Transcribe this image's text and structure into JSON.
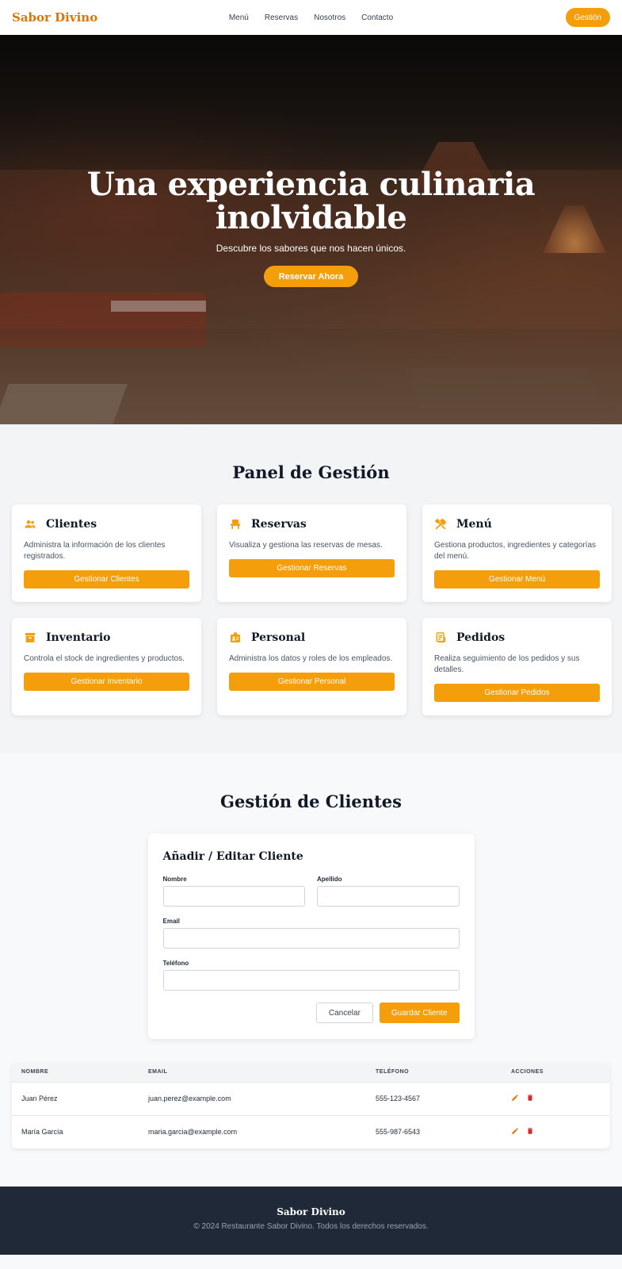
{
  "nav": {
    "brand": "Sabor Divino",
    "links": [
      "Menú",
      "Reservas",
      "Nosotros",
      "Contacto"
    ],
    "gestion_label": "Gestión"
  },
  "hero": {
    "title_line1": "Una experiencia culinaria",
    "title_line2": "inolvidable",
    "subtitle": "Descubre los sabores que nos hacen únicos.",
    "cta_label": "Reservar Ahora"
  },
  "panel": {
    "title": "Panel de Gestión",
    "cards": [
      {
        "title": "Clientes",
        "icon": "users-icon",
        "desc": "Administra la información de los clientes registrados.",
        "button": "Gestionar Clientes"
      },
      {
        "title": "Reservas",
        "icon": "chair-icon",
        "desc": "Visualiza y gestiona las reservas de mesas.",
        "button": "Gestionar Reservas"
      },
      {
        "title": "Menú",
        "icon": "utensils-icon",
        "desc": "Gestiona productos, ingredientes y categorías del menú.",
        "button": "Gestionar Menú"
      },
      {
        "title": "Inventario",
        "icon": "archive-box-icon",
        "desc": "Controla el stock de ingredientes y productos.",
        "button": "Gestionar Inventario"
      },
      {
        "title": "Personal",
        "icon": "id-badge-icon",
        "desc": "Administra los datos y roles de los empleados.",
        "button": "Gestionar Personal"
      },
      {
        "title": "Pedidos",
        "icon": "receipt-icon",
        "desc": "Realiza seguimiento de los pedidos y sus detalles.",
        "button": "Gestionar Pedidos"
      }
    ]
  },
  "clientes": {
    "title": "Gestión de Clientes",
    "form": {
      "title": "Añadir / Editar Cliente",
      "nombre_label": "Nombre",
      "nombre_value": "",
      "apellido_label": "Apellido",
      "apellido_value": "",
      "email_label": "Email",
      "email_value": "",
      "telefono_label": "Teléfono",
      "telefono_value": "",
      "cancel_label": "Cancelar",
      "save_label": "Guardar Cliente"
    },
    "table": {
      "headers": [
        "NOMBRE",
        "EMAIL",
        "TELÉFONO",
        "ACCIONES"
      ],
      "rows": [
        {
          "nombre": "Juan Pérez",
          "email": "juan.perez@example.com",
          "telefono": "555-123-4567"
        },
        {
          "nombre": "María García",
          "email": "maria.garcia@example.com",
          "telefono": "555-987-6543"
        }
      ]
    }
  },
  "footer": {
    "brand": "Sabor Divino",
    "copy": "© 2024 Restaurante Sabor Divino. Todos los derechos reservados."
  },
  "colors": {
    "accent": "#f59e0b",
    "brand": "#d97706",
    "footer_bg": "#1f2937",
    "delete": "#dc2626"
  }
}
